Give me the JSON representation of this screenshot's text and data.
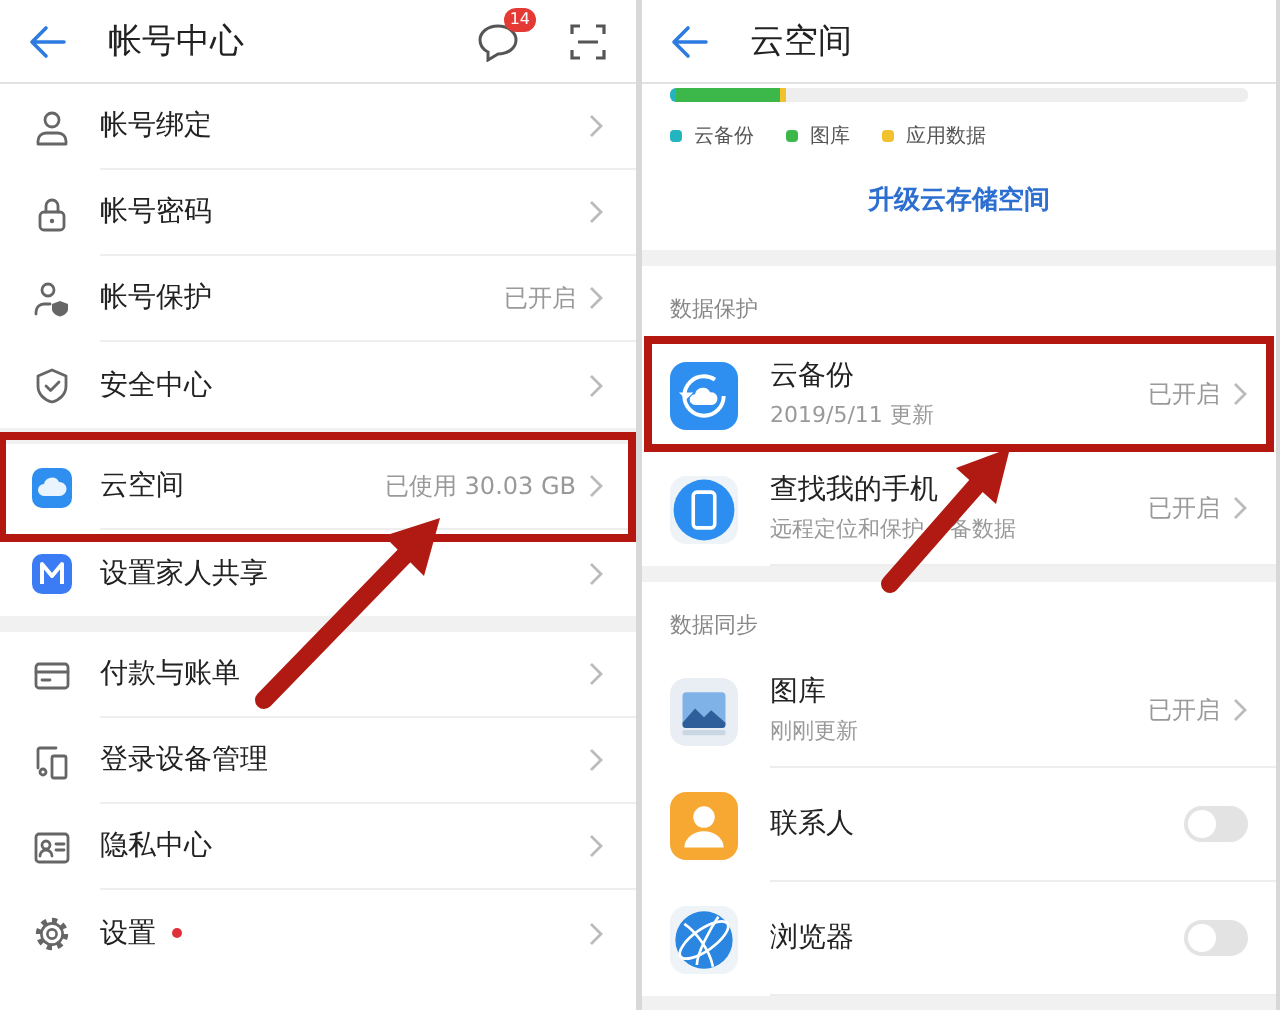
{
  "account_center": {
    "title": "帐号中心",
    "badge": "14",
    "groups": [
      {
        "items": [
          {
            "label": "帐号绑定",
            "highlighted": false,
            "dot": false
          },
          {
            "label": "帐号密码",
            "highlighted": false,
            "dot": false
          },
          {
            "label": "帐号保护",
            "value": "已开启",
            "highlighted": false,
            "dot": false
          },
          {
            "label": "安全中心",
            "highlighted": false,
            "dot": false
          }
        ]
      },
      {
        "items": [
          {
            "label": "云空间",
            "value": "已使用 30.03 GB",
            "highlighted": true,
            "dot": false
          },
          {
            "label": "设置家人共享",
            "highlighted": false,
            "dot": false
          }
        ]
      },
      {
        "items": [
          {
            "label": "付款与账单",
            "highlighted": false,
            "dot": false
          },
          {
            "label": "登录设备管理",
            "highlighted": false,
            "dot": false
          },
          {
            "label": "隐私中心",
            "highlighted": false,
            "dot": false
          },
          {
            "label": "设置",
            "highlighted": false,
            "dot": true
          }
        ]
      }
    ]
  },
  "cloud_space": {
    "title": "云空间",
    "storage": {
      "bar": [
        {
          "color": "#22b5c0",
          "level": 0.01
        },
        {
          "color": "#3cb84a",
          "level": 0.18
        },
        {
          "color": "#f2c12e",
          "level": 0.01
        }
      ],
      "legend": [
        {
          "label": "云备份",
          "color": "#22b5c0"
        },
        {
          "label": "图库",
          "color": "#3cb84a"
        },
        {
          "label": "应用数据",
          "color": "#f2c12e"
        }
      ],
      "button": "升级云存储空间"
    },
    "sections": [
      {
        "heading": "数据保护",
        "items": [
          {
            "kind": "link",
            "title": "云备份",
            "subtitle": "2019/5/11 更新",
            "value": "已开启",
            "highlighted": true
          },
          {
            "kind": "link",
            "title": "查找我的手机",
            "subtitle": "远程定位和保护",
            "subtitle_after_arrow": "备数据",
            "value": "已开启",
            "highlighted": false
          }
        ]
      },
      {
        "heading": "数据同步",
        "items": [
          {
            "kind": "link",
            "title": "图库",
            "subtitle": "刚刚更新",
            "value": "已开启",
            "highlighted": false
          },
          {
            "kind": "toggle",
            "title": "联系人",
            "on": false,
            "highlighted": false
          },
          {
            "kind": "toggle",
            "title": "浏览器",
            "on": false,
            "highlighted": false
          }
        ]
      }
    ]
  }
}
